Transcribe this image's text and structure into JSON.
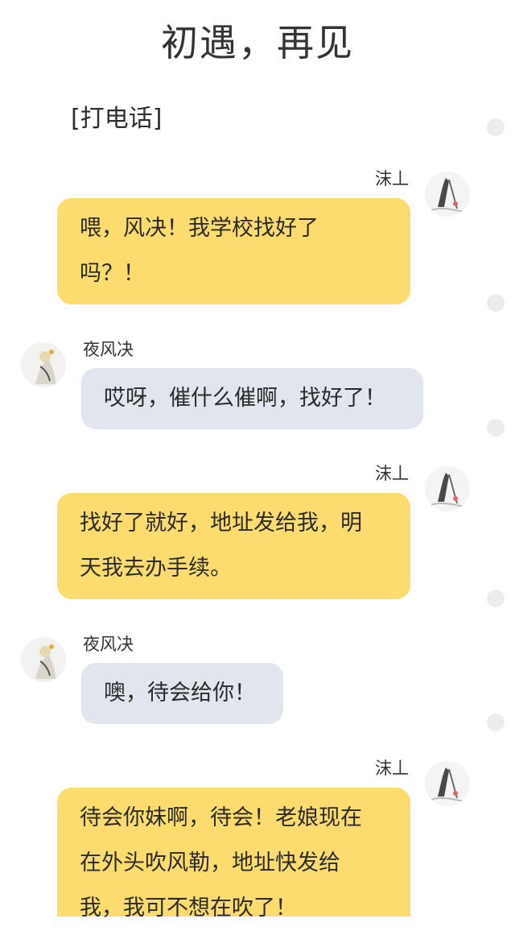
{
  "page": {
    "title": "初遇，再见"
  },
  "note": "[打电话]",
  "contacts": {
    "me": "沫丄",
    "other": "夜风决"
  },
  "messages": [
    {
      "sender": "沫丄",
      "direction": "outgoing",
      "lines": [
        "喂，风决！我学校找好了",
        "吗？！"
      ]
    },
    {
      "sender": "夜风决",
      "direction": "incoming",
      "lines": [
        "哎呀，催什么催啊，找好了！"
      ]
    },
    {
      "sender": "沫丄",
      "direction": "outgoing",
      "lines": [
        "找好了就好，地址发给我，明",
        "天我去办手续。"
      ]
    },
    {
      "sender": "夜风决",
      "direction": "incoming",
      "lines": [
        "噢，待会给你！"
      ]
    },
    {
      "sender": "沫丄",
      "direction": "outgoing",
      "lines": [
        "待会你妹啊，待会！老娘现在",
        "在外头吹风勒，地址快发给",
        "我，我可不想在吹了！"
      ]
    }
  ],
  "icons": {
    "avatar_me": "ink-painting-avatar",
    "avatar_other": "ink-figure-avatar"
  }
}
